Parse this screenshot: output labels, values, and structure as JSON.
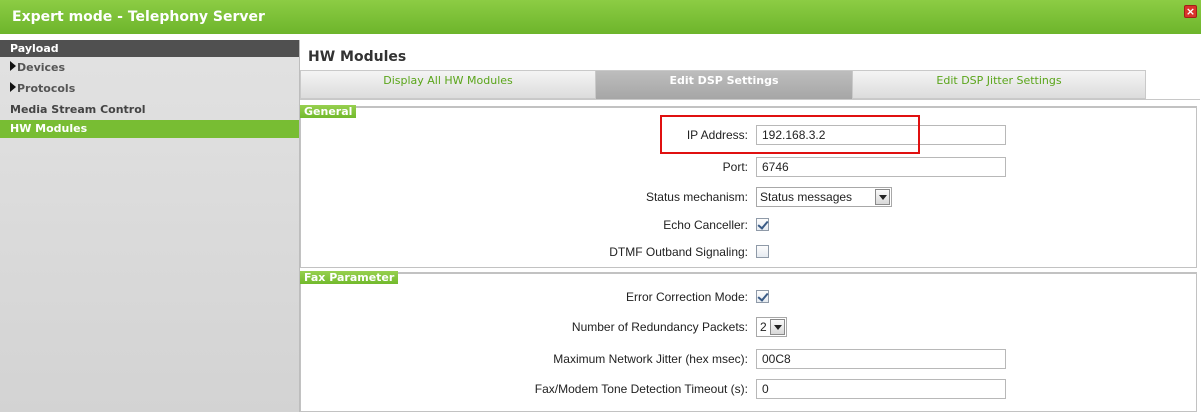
{
  "window": {
    "title": "Expert mode - Telephony Server",
    "close_label": "×"
  },
  "sidebar": {
    "header": "Payload",
    "items": [
      {
        "label": "Devices",
        "type": "folder"
      },
      {
        "label": "Protocols",
        "type": "folder"
      },
      {
        "label": "Media Stream Control",
        "type": "item"
      },
      {
        "label": "HW Modules",
        "type": "item",
        "active": true
      }
    ]
  },
  "main": {
    "title": "HW Modules",
    "tabs": [
      {
        "label": "Display All HW Modules",
        "active": false
      },
      {
        "label": "Edit DSP Settings",
        "active": true
      },
      {
        "label": "Edit DSP Jitter Settings",
        "active": false
      }
    ]
  },
  "general": {
    "section_label": "General",
    "ip_address": {
      "label": "IP Address:",
      "value": "192.168.3.2"
    },
    "port": {
      "label": "Port:",
      "value": "6746"
    },
    "status_mechanism": {
      "label": "Status mechanism:",
      "value": "Status messages"
    },
    "echo_canceller": {
      "label": "Echo Canceller:",
      "checked": true
    },
    "dtmf_outband": {
      "label": "DTMF Outband Signaling:",
      "checked": false
    }
  },
  "fax": {
    "section_label": "Fax Parameter",
    "error_correction": {
      "label": "Error Correction Mode:",
      "checked": true
    },
    "redundancy_packets": {
      "label": "Number of Redundancy Packets:",
      "value": "2"
    },
    "max_jitter": {
      "label": "Maximum Network Jitter (hex msec):",
      "value": "00C8"
    },
    "tone_timeout": {
      "label": "Fax/Modem Tone Detection Timeout (s):",
      "value": "0"
    }
  },
  "colors": {
    "brand_green": "#78bd33",
    "highlight_red": "#e01010"
  }
}
